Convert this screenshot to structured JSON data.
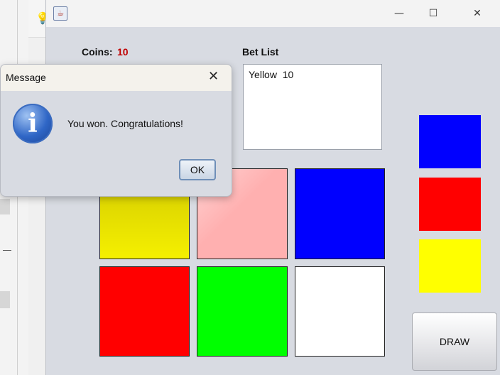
{
  "background_ide": {
    "icon": "lightbulb-icon"
  },
  "window": {
    "app_icon": "java-cup-icon",
    "minimize_glyph": "—",
    "maximize_glyph": "☐",
    "close_glyph": "✕"
  },
  "game": {
    "coins_label": "Coins:",
    "coins_value": "10",
    "bet_list_label": "Bet List",
    "bet_list_items": [
      "Yellow  10"
    ],
    "tiles": [
      {
        "name": "tile-yellow",
        "color": "#f5f000"
      },
      {
        "name": "tile-pink",
        "color": "#ffb0b0"
      },
      {
        "name": "tile-blue",
        "color": "#0000ff"
      },
      {
        "name": "tile-red",
        "color": "#ff0000"
      },
      {
        "name": "tile-green",
        "color": "#00ff00"
      },
      {
        "name": "tile-white",
        "color": "#ffffff"
      }
    ],
    "drawn_colors": [
      "#0000ff",
      "#ff0000",
      "#ffff00"
    ],
    "draw_button": "DRAW"
  },
  "dialog": {
    "title": "Message",
    "close_glyph": "✕",
    "icon": "info-icon",
    "icon_glyph": "i",
    "message": "You won. Congratulations!",
    "ok_label": "OK"
  }
}
